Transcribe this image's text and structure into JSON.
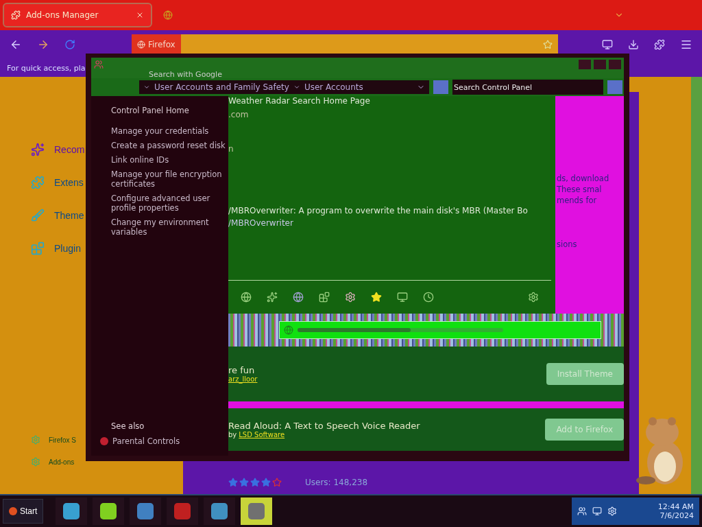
{
  "browser": {
    "tabs": [
      {
        "label": "Add-ons Manager",
        "selected": true
      },
      {
        "selected": false
      }
    ],
    "identity": "Firefox",
    "bookmarks_hint": "For quick access, pla",
    "sidebar": {
      "items": [
        {
          "label": "Recom",
          "selected": true
        },
        {
          "label": "Extens",
          "selected": false
        },
        {
          "label": "Theme",
          "selected": false
        },
        {
          "label": "Plugin",
          "selected": false
        }
      ],
      "footer": [
        "Firefox S",
        "Add-ons"
      ]
    },
    "content": {
      "stars": 4,
      "users": "Users: 148,238"
    }
  },
  "control_panel": {
    "breadcrumb": [
      "User Accounts and Family Safety",
      "User Accounts"
    ],
    "search": {
      "placeholder": "Search Control Panel"
    },
    "home": "Control Panel Home",
    "links": [
      "Manage your credentials",
      "Create a password reset disk",
      "Link online IDs",
      "Manage your file encryption certificates",
      "Configure advanced user profile properties",
      "Change my environment variables"
    ],
    "see_also": "See also",
    "see_also_links": [
      "Parental Controls"
    ],
    "overlay": {
      "search_line": "Search with Google",
      "weather_line": "Weather Radar Search Home Page",
      "lines": [
        ".com",
        "n"
      ],
      "repo": "/MBROverwriter: A program to overwrite the main disk's MBR (Master Bo",
      "repo_path": "/MBROverwriter",
      "side_lines": [
        "ds, download",
        "These smal",
        "mends for",
        "sions"
      ],
      "progress": {
        "level": 0.55
      },
      "theme": {
        "title": "re fun",
        "author": "arz_lloor",
        "button": "Install Theme"
      },
      "addon": {
        "title": "Read Aloud: A Text to Speech Voice Reader",
        "by": "by",
        "author": "LSD Software",
        "button": "Add to Firefox"
      }
    }
  },
  "taskbar": {
    "start": "Start",
    "apps": [
      {
        "selected": false
      },
      {
        "selected": false
      },
      {
        "selected": false
      },
      {
        "selected": false
      },
      {
        "selected": false
      },
      {
        "selected": true
      }
    ],
    "time": "12:44 AM",
    "date": "7/6/2024"
  }
}
